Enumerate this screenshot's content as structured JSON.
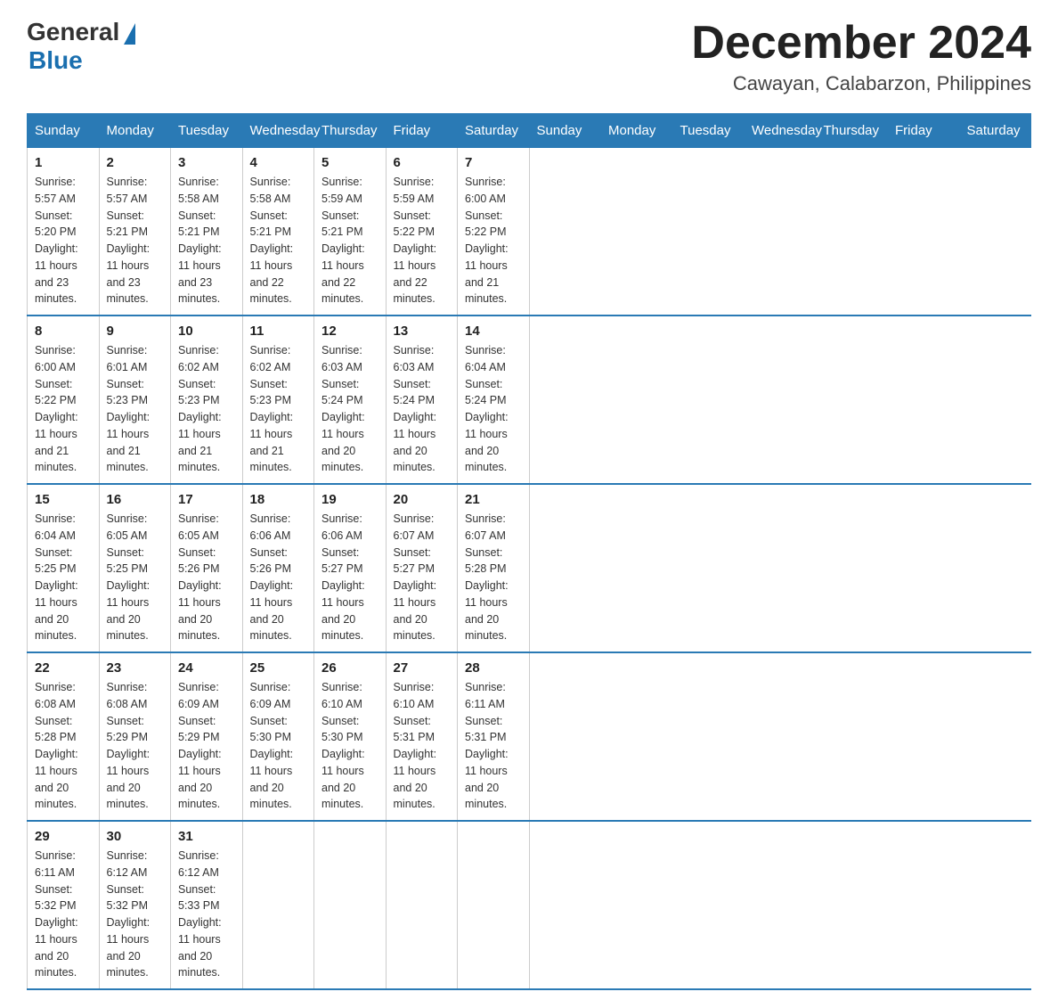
{
  "header": {
    "logo_general": "General",
    "logo_blue": "Blue",
    "month_year": "December 2024",
    "location": "Cawayan, Calabarzon, Philippines"
  },
  "days_of_week": [
    "Sunday",
    "Monday",
    "Tuesday",
    "Wednesday",
    "Thursday",
    "Friday",
    "Saturday"
  ],
  "weeks": [
    [
      {
        "day": "1",
        "sunrise": "5:57 AM",
        "sunset": "5:20 PM",
        "daylight": "11 hours and 23 minutes."
      },
      {
        "day": "2",
        "sunrise": "5:57 AM",
        "sunset": "5:21 PM",
        "daylight": "11 hours and 23 minutes."
      },
      {
        "day": "3",
        "sunrise": "5:58 AM",
        "sunset": "5:21 PM",
        "daylight": "11 hours and 23 minutes."
      },
      {
        "day": "4",
        "sunrise": "5:58 AM",
        "sunset": "5:21 PM",
        "daylight": "11 hours and 22 minutes."
      },
      {
        "day": "5",
        "sunrise": "5:59 AM",
        "sunset": "5:21 PM",
        "daylight": "11 hours and 22 minutes."
      },
      {
        "day": "6",
        "sunrise": "5:59 AM",
        "sunset": "5:22 PM",
        "daylight": "11 hours and 22 minutes."
      },
      {
        "day": "7",
        "sunrise": "6:00 AM",
        "sunset": "5:22 PM",
        "daylight": "11 hours and 21 minutes."
      }
    ],
    [
      {
        "day": "8",
        "sunrise": "6:00 AM",
        "sunset": "5:22 PM",
        "daylight": "11 hours and 21 minutes."
      },
      {
        "day": "9",
        "sunrise": "6:01 AM",
        "sunset": "5:23 PM",
        "daylight": "11 hours and 21 minutes."
      },
      {
        "day": "10",
        "sunrise": "6:02 AM",
        "sunset": "5:23 PM",
        "daylight": "11 hours and 21 minutes."
      },
      {
        "day": "11",
        "sunrise": "6:02 AM",
        "sunset": "5:23 PM",
        "daylight": "11 hours and 21 minutes."
      },
      {
        "day": "12",
        "sunrise": "6:03 AM",
        "sunset": "5:24 PM",
        "daylight": "11 hours and 20 minutes."
      },
      {
        "day": "13",
        "sunrise": "6:03 AM",
        "sunset": "5:24 PM",
        "daylight": "11 hours and 20 minutes."
      },
      {
        "day": "14",
        "sunrise": "6:04 AM",
        "sunset": "5:24 PM",
        "daylight": "11 hours and 20 minutes."
      }
    ],
    [
      {
        "day": "15",
        "sunrise": "6:04 AM",
        "sunset": "5:25 PM",
        "daylight": "11 hours and 20 minutes."
      },
      {
        "day": "16",
        "sunrise": "6:05 AM",
        "sunset": "5:25 PM",
        "daylight": "11 hours and 20 minutes."
      },
      {
        "day": "17",
        "sunrise": "6:05 AM",
        "sunset": "5:26 PM",
        "daylight": "11 hours and 20 minutes."
      },
      {
        "day": "18",
        "sunrise": "6:06 AM",
        "sunset": "5:26 PM",
        "daylight": "11 hours and 20 minutes."
      },
      {
        "day": "19",
        "sunrise": "6:06 AM",
        "sunset": "5:27 PM",
        "daylight": "11 hours and 20 minutes."
      },
      {
        "day": "20",
        "sunrise": "6:07 AM",
        "sunset": "5:27 PM",
        "daylight": "11 hours and 20 minutes."
      },
      {
        "day": "21",
        "sunrise": "6:07 AM",
        "sunset": "5:28 PM",
        "daylight": "11 hours and 20 minutes."
      }
    ],
    [
      {
        "day": "22",
        "sunrise": "6:08 AM",
        "sunset": "5:28 PM",
        "daylight": "11 hours and 20 minutes."
      },
      {
        "day": "23",
        "sunrise": "6:08 AM",
        "sunset": "5:29 PM",
        "daylight": "11 hours and 20 minutes."
      },
      {
        "day": "24",
        "sunrise": "6:09 AM",
        "sunset": "5:29 PM",
        "daylight": "11 hours and 20 minutes."
      },
      {
        "day": "25",
        "sunrise": "6:09 AM",
        "sunset": "5:30 PM",
        "daylight": "11 hours and 20 minutes."
      },
      {
        "day": "26",
        "sunrise": "6:10 AM",
        "sunset": "5:30 PM",
        "daylight": "11 hours and 20 minutes."
      },
      {
        "day": "27",
        "sunrise": "6:10 AM",
        "sunset": "5:31 PM",
        "daylight": "11 hours and 20 minutes."
      },
      {
        "day": "28",
        "sunrise": "6:11 AM",
        "sunset": "5:31 PM",
        "daylight": "11 hours and 20 minutes."
      }
    ],
    [
      {
        "day": "29",
        "sunrise": "6:11 AM",
        "sunset": "5:32 PM",
        "daylight": "11 hours and 20 minutes."
      },
      {
        "day": "30",
        "sunrise": "6:12 AM",
        "sunset": "5:32 PM",
        "daylight": "11 hours and 20 minutes."
      },
      {
        "day": "31",
        "sunrise": "6:12 AM",
        "sunset": "5:33 PM",
        "daylight": "11 hours and 20 minutes."
      },
      null,
      null,
      null,
      null
    ]
  ],
  "labels": {
    "sunrise_prefix": "Sunrise: ",
    "sunset_prefix": "Sunset: ",
    "daylight_prefix": "Daylight: "
  }
}
